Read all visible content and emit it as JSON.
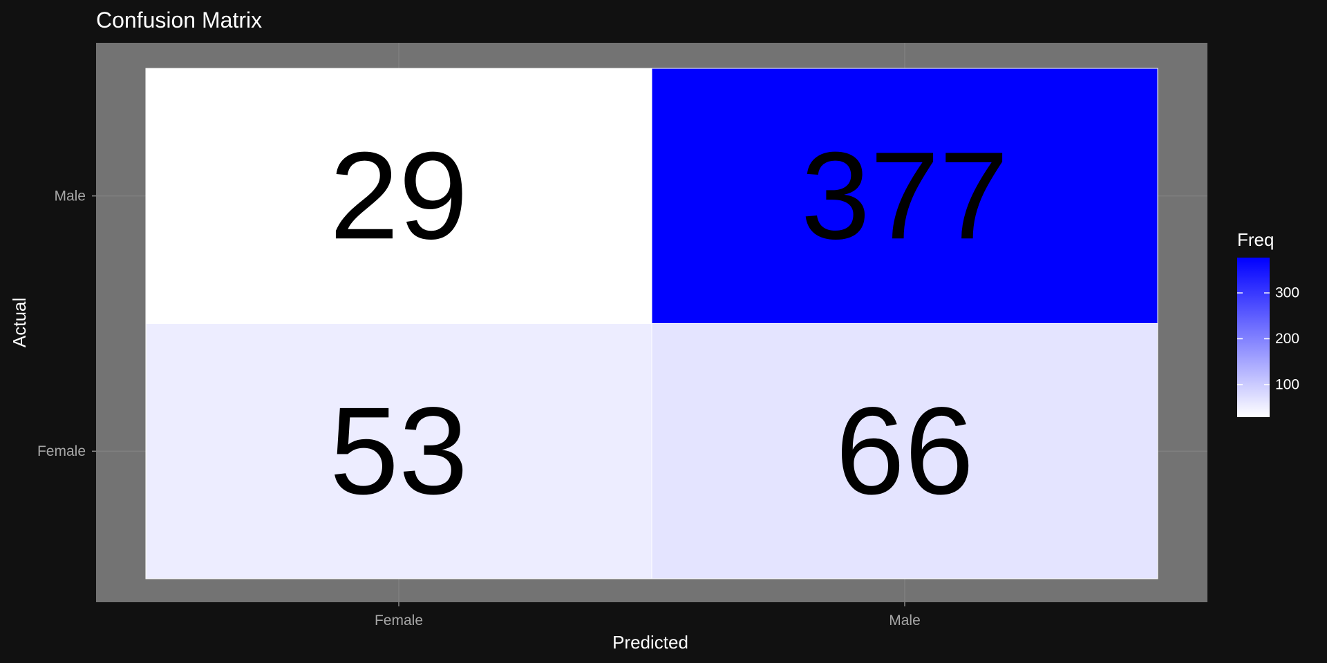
{
  "chart_data": {
    "type": "heatmap",
    "title": "Confusion Matrix",
    "xlabel": "Predicted",
    "ylabel": "Actual",
    "x_categories": [
      "Female",
      "Male"
    ],
    "y_categories": [
      "Female",
      "Male"
    ],
    "cells": [
      {
        "predicted": "Female",
        "actual": "Male",
        "freq": 29
      },
      {
        "predicted": "Male",
        "actual": "Male",
        "freq": 377
      },
      {
        "predicted": "Female",
        "actual": "Female",
        "freq": 53
      },
      {
        "predicted": "Male",
        "actual": "Female",
        "freq": 66
      }
    ],
    "legend": {
      "title": "Freq",
      "ticks": [
        100,
        200,
        300
      ],
      "range": [
        29,
        377
      ],
      "low_color": "#ffffff",
      "high_color": "#0000ff",
      "placement": "right"
    },
    "grid": true,
    "panel_background": "#737373",
    "page_background": "#111111"
  }
}
